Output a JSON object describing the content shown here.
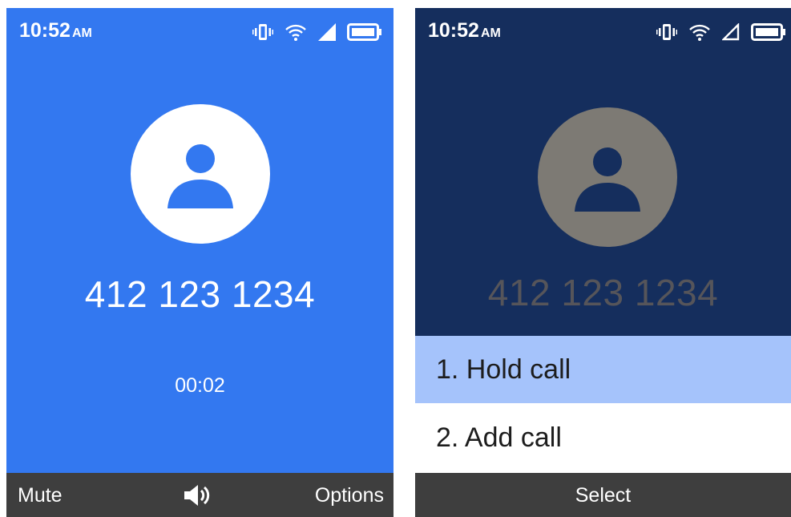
{
  "colors": {
    "left_background": "#3378f0",
    "right_background": "#152e5d",
    "softkey_bar": "#3e3e3e",
    "menu_highlight": "#a5c3fb"
  },
  "active_call": {
    "status_bar": {
      "time": "10:52",
      "ampm": "AM",
      "icons": [
        "vibrate-icon",
        "wifi-icon",
        "signal-icon",
        "battery-icon"
      ]
    },
    "contact": {
      "avatar_icon": "person-icon",
      "phone_number": "412 123 1234"
    },
    "call_timer": "00:02",
    "softkeys": {
      "left": "Mute",
      "center_icon": "speaker-icon",
      "right": "Options"
    }
  },
  "options_menu": {
    "status_bar": {
      "time": "10:52",
      "ampm": "AM",
      "icons": [
        "vibrate-icon",
        "wifi-icon",
        "signal-icon",
        "battery-icon"
      ]
    },
    "contact": {
      "avatar_icon": "person-icon",
      "phone_number": "412 123 1234"
    },
    "menu": {
      "items": [
        {
          "label": "1. Hold call",
          "selected": true
        },
        {
          "label": "2. Add call",
          "selected": false
        }
      ]
    },
    "softkeys": {
      "center": "Select"
    }
  }
}
